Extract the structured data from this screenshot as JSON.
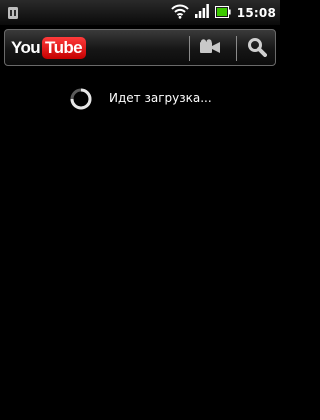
{
  "status_bar": {
    "time": "15:08",
    "icons": [
      "debug-icon",
      "wifi-icon",
      "signal-icon",
      "battery-icon"
    ]
  },
  "action_bar": {
    "logo": {
      "you": "You",
      "tube": "Tube"
    },
    "icons": [
      "video-camera-icon",
      "search-icon"
    ]
  },
  "loading": {
    "text": "Идет загрузка..."
  },
  "colors": {
    "background": "#000000",
    "logo_red": "#e00000",
    "battery_green": "#3cc800"
  }
}
